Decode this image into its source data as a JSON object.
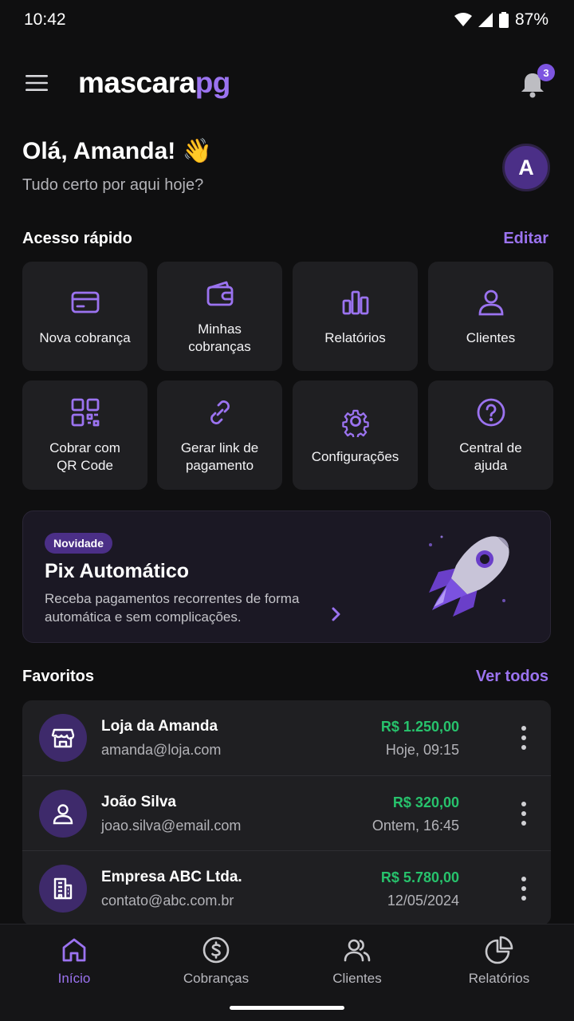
{
  "status_bar": {
    "time": "10:42",
    "battery": "87%"
  },
  "app_bar": {
    "logo_main": "mascara",
    "logo_accent": "pg",
    "notification_count": "3"
  },
  "greeting": {
    "title": "Olá, Amanda! 👋",
    "subtitle": "Tudo certo por aqui hoje?",
    "avatar_initial": "A"
  },
  "quick_access": {
    "title": "Acesso rápido",
    "edit_label": "Editar",
    "items": [
      {
        "label": "Nova cobrança",
        "icon": "card-icon"
      },
      {
        "label": "Minhas cobranças",
        "icon": "wallet-icon"
      },
      {
        "label": "Relatórios",
        "icon": "bar-chart-icon"
      },
      {
        "label": "Clientes",
        "icon": "user-icon"
      },
      {
        "label": "Cobrar com QR Code",
        "icon": "qr-code-icon"
      },
      {
        "label": "Gerar link de pagamento",
        "icon": "link-icon"
      },
      {
        "label": "Configurações",
        "icon": "gear-icon"
      },
      {
        "label": "Central de ajuda",
        "icon": "help-icon"
      }
    ]
  },
  "promo": {
    "badge": "Novidade",
    "title": "Pix Automático",
    "text": "Receba pagamentos recorrentes de forma automática e sem complicações."
  },
  "favorites": {
    "title": "Favoritos",
    "see_all_label": "Ver todos",
    "items": [
      {
        "name": "Loja da Amanda",
        "email": "amanda@loja.com",
        "amount": "R$ 1.250,00",
        "date": "Hoje, 09:15",
        "icon": "store-icon"
      },
      {
        "name": "João Silva",
        "email": "joao.silva@email.com",
        "amount": "R$ 320,00",
        "date": "Ontem, 16:45",
        "icon": "user-icon"
      },
      {
        "name": "Empresa ABC Ltda.",
        "email": "contato@abc.com.br",
        "amount": "R$ 5.780,00",
        "date": "12/05/2024",
        "icon": "building-icon"
      }
    ]
  },
  "bottom_nav": {
    "items": [
      {
        "label": "Início",
        "icon": "home-icon",
        "active": true
      },
      {
        "label": "Cobranças",
        "icon": "dollar-icon",
        "active": false
      },
      {
        "label": "Clientes",
        "icon": "users-icon",
        "active": false
      },
      {
        "label": "Relatórios",
        "icon": "pie-chart-icon",
        "active": false
      }
    ]
  },
  "colors": {
    "accent": "#9b73f0",
    "positive": "#27c26c",
    "background": "#0f0f10",
    "card": "#1f1f22"
  }
}
